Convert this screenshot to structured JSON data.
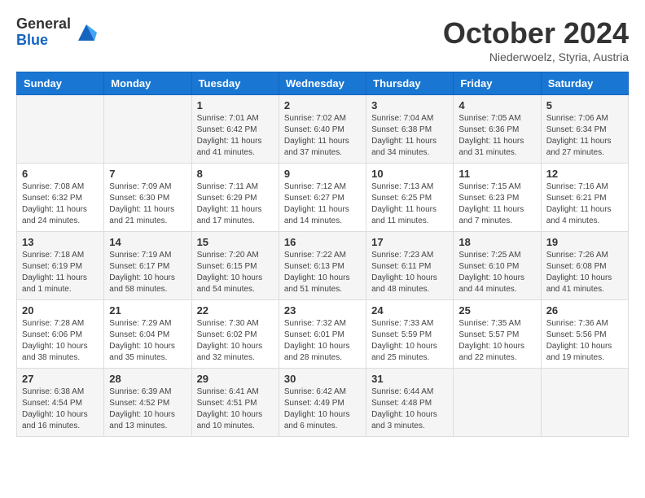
{
  "logo": {
    "general": "General",
    "blue": "Blue"
  },
  "title": "October 2024",
  "subtitle": "Niederwoelz, Styria, Austria",
  "days_of_week": [
    "Sunday",
    "Monday",
    "Tuesday",
    "Wednesday",
    "Thursday",
    "Friday",
    "Saturday"
  ],
  "weeks": [
    [
      {
        "day": "",
        "content": ""
      },
      {
        "day": "",
        "content": ""
      },
      {
        "day": "1",
        "content": "Sunrise: 7:01 AM\nSunset: 6:42 PM\nDaylight: 11 hours and 41 minutes."
      },
      {
        "day": "2",
        "content": "Sunrise: 7:02 AM\nSunset: 6:40 PM\nDaylight: 11 hours and 37 minutes."
      },
      {
        "day": "3",
        "content": "Sunrise: 7:04 AM\nSunset: 6:38 PM\nDaylight: 11 hours and 34 minutes."
      },
      {
        "day": "4",
        "content": "Sunrise: 7:05 AM\nSunset: 6:36 PM\nDaylight: 11 hours and 31 minutes."
      },
      {
        "day": "5",
        "content": "Sunrise: 7:06 AM\nSunset: 6:34 PM\nDaylight: 11 hours and 27 minutes."
      }
    ],
    [
      {
        "day": "6",
        "content": "Sunrise: 7:08 AM\nSunset: 6:32 PM\nDaylight: 11 hours and 24 minutes."
      },
      {
        "day": "7",
        "content": "Sunrise: 7:09 AM\nSunset: 6:30 PM\nDaylight: 11 hours and 21 minutes."
      },
      {
        "day": "8",
        "content": "Sunrise: 7:11 AM\nSunset: 6:29 PM\nDaylight: 11 hours and 17 minutes."
      },
      {
        "day": "9",
        "content": "Sunrise: 7:12 AM\nSunset: 6:27 PM\nDaylight: 11 hours and 14 minutes."
      },
      {
        "day": "10",
        "content": "Sunrise: 7:13 AM\nSunset: 6:25 PM\nDaylight: 11 hours and 11 minutes."
      },
      {
        "day": "11",
        "content": "Sunrise: 7:15 AM\nSunset: 6:23 PM\nDaylight: 11 hours and 7 minutes."
      },
      {
        "day": "12",
        "content": "Sunrise: 7:16 AM\nSunset: 6:21 PM\nDaylight: 11 hours and 4 minutes."
      }
    ],
    [
      {
        "day": "13",
        "content": "Sunrise: 7:18 AM\nSunset: 6:19 PM\nDaylight: 11 hours and 1 minute."
      },
      {
        "day": "14",
        "content": "Sunrise: 7:19 AM\nSunset: 6:17 PM\nDaylight: 10 hours and 58 minutes."
      },
      {
        "day": "15",
        "content": "Sunrise: 7:20 AM\nSunset: 6:15 PM\nDaylight: 10 hours and 54 minutes."
      },
      {
        "day": "16",
        "content": "Sunrise: 7:22 AM\nSunset: 6:13 PM\nDaylight: 10 hours and 51 minutes."
      },
      {
        "day": "17",
        "content": "Sunrise: 7:23 AM\nSunset: 6:11 PM\nDaylight: 10 hours and 48 minutes."
      },
      {
        "day": "18",
        "content": "Sunrise: 7:25 AM\nSunset: 6:10 PM\nDaylight: 10 hours and 44 minutes."
      },
      {
        "day": "19",
        "content": "Sunrise: 7:26 AM\nSunset: 6:08 PM\nDaylight: 10 hours and 41 minutes."
      }
    ],
    [
      {
        "day": "20",
        "content": "Sunrise: 7:28 AM\nSunset: 6:06 PM\nDaylight: 10 hours and 38 minutes."
      },
      {
        "day": "21",
        "content": "Sunrise: 7:29 AM\nSunset: 6:04 PM\nDaylight: 10 hours and 35 minutes."
      },
      {
        "day": "22",
        "content": "Sunrise: 7:30 AM\nSunset: 6:02 PM\nDaylight: 10 hours and 32 minutes."
      },
      {
        "day": "23",
        "content": "Sunrise: 7:32 AM\nSunset: 6:01 PM\nDaylight: 10 hours and 28 minutes."
      },
      {
        "day": "24",
        "content": "Sunrise: 7:33 AM\nSunset: 5:59 PM\nDaylight: 10 hours and 25 minutes."
      },
      {
        "day": "25",
        "content": "Sunrise: 7:35 AM\nSunset: 5:57 PM\nDaylight: 10 hours and 22 minutes."
      },
      {
        "day": "26",
        "content": "Sunrise: 7:36 AM\nSunset: 5:56 PM\nDaylight: 10 hours and 19 minutes."
      }
    ],
    [
      {
        "day": "27",
        "content": "Sunrise: 6:38 AM\nSunset: 4:54 PM\nDaylight: 10 hours and 16 minutes."
      },
      {
        "day": "28",
        "content": "Sunrise: 6:39 AM\nSunset: 4:52 PM\nDaylight: 10 hours and 13 minutes."
      },
      {
        "day": "29",
        "content": "Sunrise: 6:41 AM\nSunset: 4:51 PM\nDaylight: 10 hours and 10 minutes."
      },
      {
        "day": "30",
        "content": "Sunrise: 6:42 AM\nSunset: 4:49 PM\nDaylight: 10 hours and 6 minutes."
      },
      {
        "day": "31",
        "content": "Sunrise: 6:44 AM\nSunset: 4:48 PM\nDaylight: 10 hours and 3 minutes."
      },
      {
        "day": "",
        "content": ""
      },
      {
        "day": "",
        "content": ""
      }
    ]
  ]
}
